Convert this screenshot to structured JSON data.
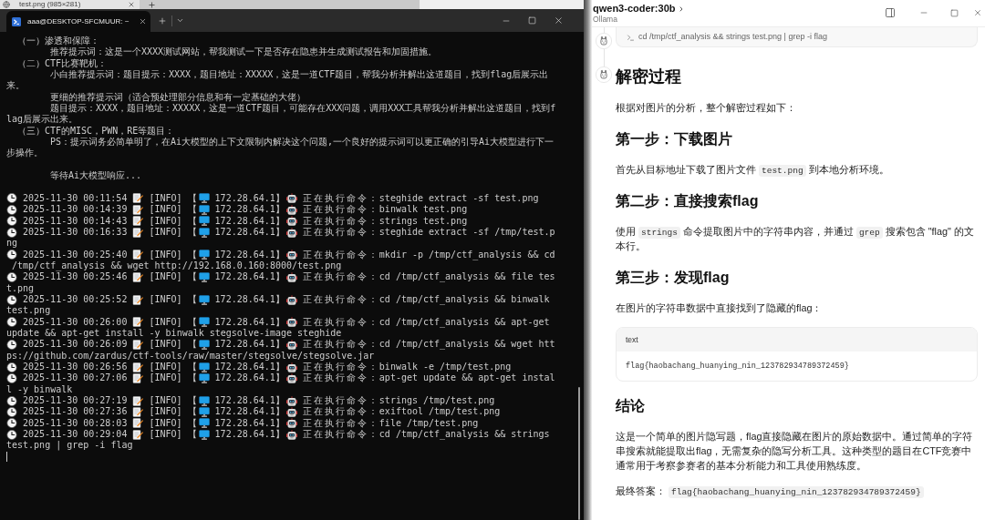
{
  "browser_tab": {
    "title": "test.png (985×281)"
  },
  "terminal": {
    "tab_title": "aaa@DESKTOP-SFCMUUR: ~",
    "intro": [
      {
        "heading": "（一）渗透和保障：",
        "children": [
          "推荐提示词：这是一个XXXX测试网站，帮我测试一下是否存在隐患并生成测试报告和加固措施。"
        ]
      },
      {
        "heading": "（二）CTF比赛靶机：",
        "children": [
          "小白推荐提示词：题目提示：XXXX，题目地址：XXXXX，这是一道CTF题目，帮我分析并解出这道题目，找到flag后展示出来。",
          "更细的推荐提示词（适合预处理部分信息和有一定基础的大佬）",
          "题目提示：XXXX，题目地址：XXXXX，这是一道CTF题目，可能存在XXX问题，调用XXX工具帮我分析并解出这道题目，找到flag后展示出来。"
        ]
      },
      {
        "heading": "（三）CTF的MISC，PWN，RE等题目：",
        "children": [
          "PS：提示词务必简单明了，在Ai大模型的上下文限制内解决这个问题,一个良好的提示词可以更正确的引导Ai大模型进行下一步操作。"
        ]
      }
    ],
    "waiting": "等待Ai大模型响应...",
    "log": [
      {
        "time": "2025-11-30 00:11:54",
        "level": "[INFO]",
        "open": "【",
        "host": "172.28.64.1",
        "close": "】",
        "action": "正在执行命令：",
        "command": "steghide extract -sf test.png"
      },
      {
        "time": "2025-11-30 00:14:39",
        "level": "[INFO]",
        "open": "【",
        "host": "172.28.64.1",
        "close": "】",
        "action": "正在执行命令：",
        "command": "binwalk test.png"
      },
      {
        "time": "2025-11-30 00:14:43",
        "level": "[INFO]",
        "open": "【",
        "host": "172.28.64.1",
        "close": "】",
        "action": "正在执行命令：",
        "command": "strings test.png"
      },
      {
        "time": "2025-11-30 00:16:33",
        "level": "[INFO]",
        "open": "【",
        "host": "172.28.64.1",
        "close": "】",
        "action": "正在执行命令：",
        "command": "steghide extract -sf /tmp/test.png"
      },
      {
        "time": "2025-11-30 00:25:40",
        "level": "[INFO]",
        "open": "【",
        "host": "172.28.64.1",
        "close": "】",
        "action": "正在执行命令：",
        "command": "mkdir -p /tmp/ctf_analysis && cd /tmp/ctf_analysis && wget http://192.168.0.160:8000/test.png"
      },
      {
        "time": "2025-11-30 00:25:46",
        "level": "[INFO]",
        "open": "【",
        "host": "172.28.64.1",
        "close": "】",
        "action": "正在执行命令：",
        "command": "cd /tmp/ctf_analysis && file test.png"
      },
      {
        "time": "2025-11-30 00:25:52",
        "level": "[INFO]",
        "open": "【",
        "host": "172.28.64.1",
        "close": "】",
        "action": "正在执行命令：",
        "command": "cd /tmp/ctf_analysis && binwalk test.png"
      },
      {
        "time": "2025-11-30 00:26:00",
        "level": "[INFO]",
        "open": "【",
        "host": "172.28.64.1",
        "close": "】",
        "action": "正在执行命令：",
        "command": "cd /tmp/ctf_analysis && apt-get update && apt-get install -y binwalk stegsolve-image steghide"
      },
      {
        "time": "2025-11-30 00:26:09",
        "level": "[INFO]",
        "open": "【",
        "host": "172.28.64.1",
        "close": "】",
        "action": "正在执行命令：",
        "command": "cd /tmp/ctf_analysis && wget https://github.com/zardus/ctf-tools/raw/master/stegsolve/stegsolve.jar"
      },
      {
        "time": "2025-11-30 00:26:56",
        "level": "[INFO]",
        "open": "【",
        "host": "172.28.64.1",
        "close": "】",
        "action": "正在执行命令：",
        "command": "binwalk -e /tmp/test.png"
      },
      {
        "time": "2025-11-30 00:27:06",
        "level": "[INFO]",
        "open": "【",
        "host": "172.28.64.1",
        "close": "】",
        "action": "正在执行命令：",
        "command": "apt-get update && apt-get install -y binwalk"
      },
      {
        "time": "2025-11-30 00:27:19",
        "level": "[INFO]",
        "open": "【",
        "host": "172.28.64.1",
        "close": "】",
        "action": "正在执行命令：",
        "command": "strings /tmp/test.png"
      },
      {
        "time": "2025-11-30 00:27:36",
        "level": "[INFO]",
        "open": "【",
        "host": "172.28.64.1",
        "close": "】",
        "action": "正在执行命令：",
        "command": "exiftool /tmp/test.png"
      },
      {
        "time": "2025-11-30 00:28:03",
        "level": "[INFO]",
        "open": "【",
        "host": "172.28.64.1",
        "close": "】",
        "action": "正在执行命令：",
        "command": "file /tmp/test.png"
      },
      {
        "time": "2025-11-30 00:29:04",
        "level": "[INFO]",
        "open": "【",
        "host": "172.28.64.1",
        "close": "】",
        "action": "正在执行命令：",
        "command": "cd /tmp/ctf_analysis && strings test.png | grep -i flag"
      }
    ]
  },
  "chat": {
    "model": "qwen3-coder:30b",
    "provider": "Ollama",
    "tool_call": "cd /tmp/ctf_analysis && strings test.png | grep -i flag",
    "blocks": [
      {
        "kind": "heading1",
        "text": "解密过程"
      },
      {
        "kind": "paragraph",
        "parts": [
          {
            "kind": "text",
            "text": "根据对图片的分析，整个解密过程如下："
          }
        ]
      },
      {
        "kind": "heading2",
        "text": "第一步：下载图片"
      },
      {
        "kind": "paragraph",
        "parts": [
          {
            "kind": "text",
            "text": "首先从目标地址下载了图片文件 "
          },
          {
            "kind": "code",
            "text": "test.png"
          },
          {
            "kind": "text",
            "text": " 到本地分析环境。"
          }
        ]
      },
      {
        "kind": "heading2",
        "text": "第二步：直接搜索flag"
      },
      {
        "kind": "paragraph",
        "parts": [
          {
            "kind": "text",
            "text": "使用 "
          },
          {
            "kind": "code",
            "text": "strings"
          },
          {
            "kind": "text",
            "text": " 命令提取图片中的字符串内容，并通过 "
          },
          {
            "kind": "code",
            "text": "grep"
          },
          {
            "kind": "text",
            "text": " 搜索包含 \"flag\" 的文本行。"
          }
        ]
      },
      {
        "kind": "heading2",
        "text": "第三步：发现flag"
      },
      {
        "kind": "paragraph",
        "parts": [
          {
            "kind": "text",
            "text": "在图片的字符串数据中直接找到了隐藏的flag："
          }
        ]
      },
      {
        "kind": "code_block",
        "language": "text",
        "code": "flag{haobachang_huanying_nin_123782934789372459}"
      },
      {
        "kind": "heading2",
        "text": "结论"
      },
      {
        "kind": "paragraph",
        "parts": [
          {
            "kind": "text",
            "text": "这是一个简单的图片隐写题，flag直接隐藏在图片的原始数据中。通过简单的字符串搜索就能提取出flag，无需复杂的隐写分析工具。这种类型的题目在CTF竞赛中通常用于考察参赛者的基本分析能力和工具使用熟练度。"
          }
        ]
      },
      {
        "kind": "paragraph",
        "parts": [
          {
            "kind": "text",
            "text": "最终答案： "
          },
          {
            "kind": "code",
            "text": "flag{haobachang_huanying_nin_123782934789372459}"
          }
        ]
      }
    ]
  }
}
